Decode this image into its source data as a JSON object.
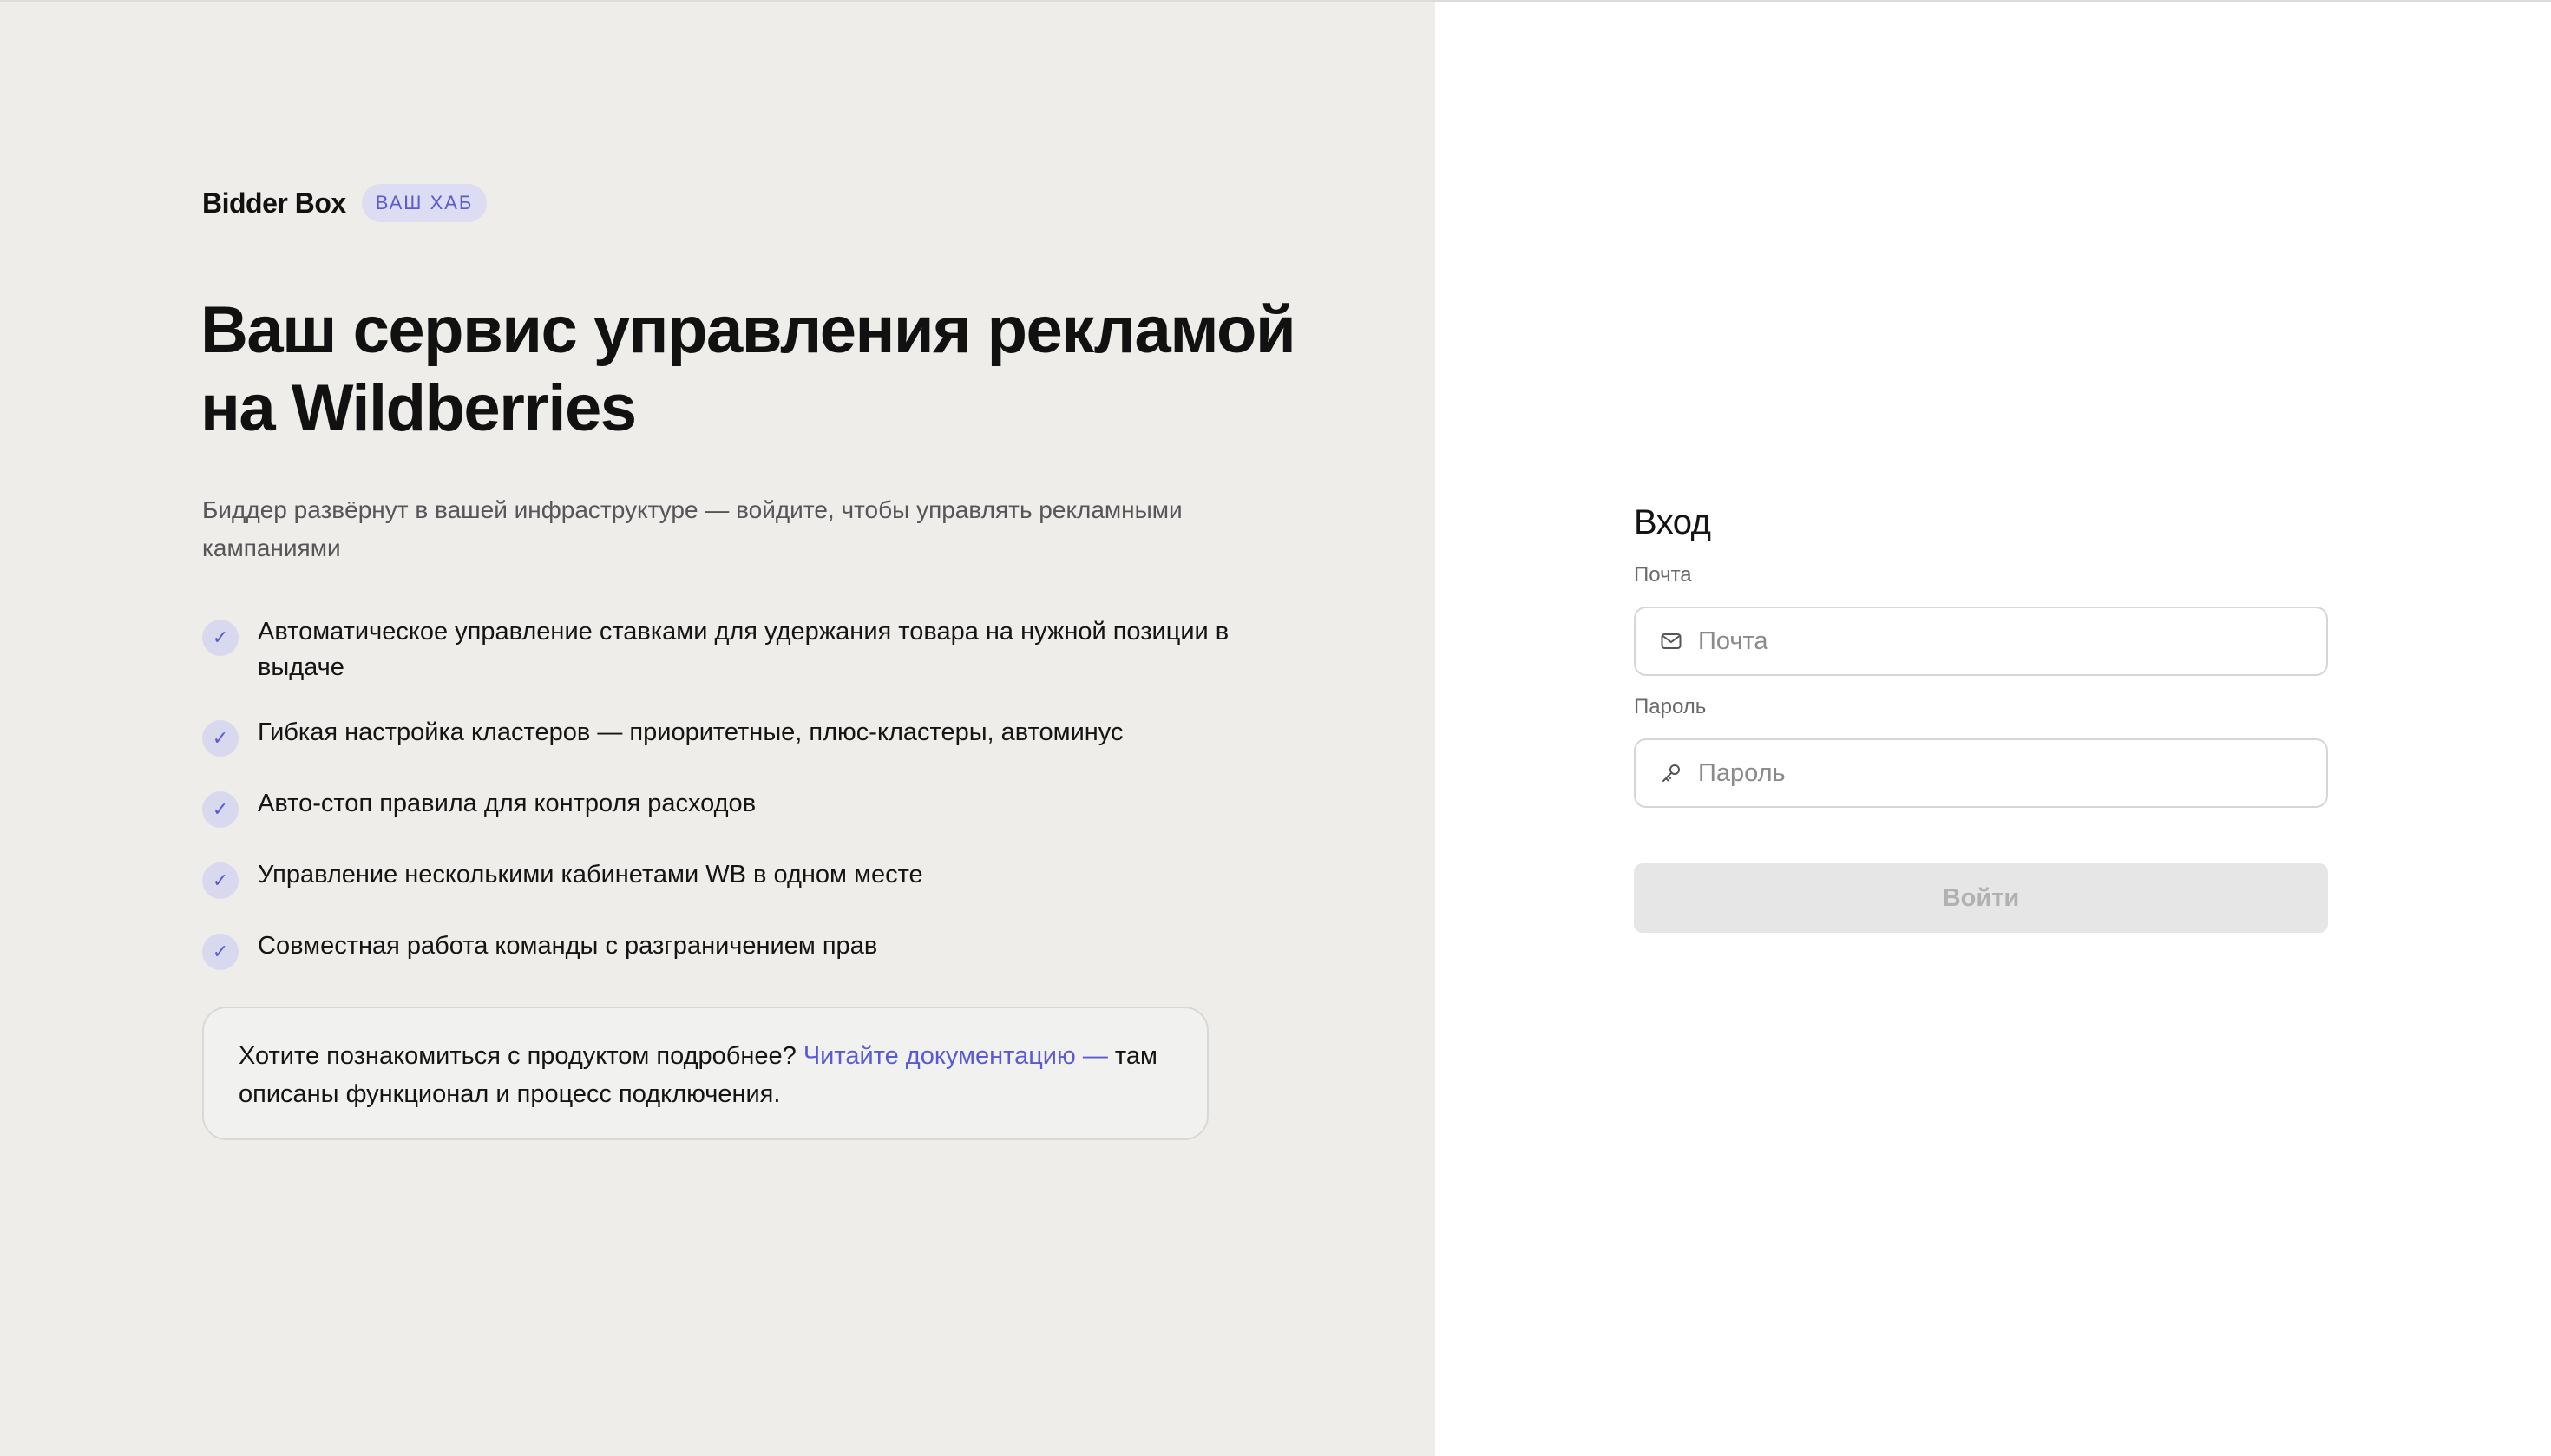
{
  "brand": {
    "name": "Bidder Box",
    "badge": "ВАШ ХАБ"
  },
  "hero": {
    "title": "Ваш сервис управления рекламой на Wildberries",
    "subtitle": "Биддер развёрнут в вашей инфраструктуре — войдите, чтобы управлять рекламными кампаниями"
  },
  "features": [
    "Автоматическое управление ставками для удержания товара на нужной позиции в выдаче",
    "Гибкая настройка кластеров — приоритетные, плюс-кластеры, автоминус",
    "Авто-стоп правила для контроля расходов",
    "Управление несколькими кабинетами WB в одном месте",
    "Совместная работа команды с разграничением прав"
  ],
  "info": {
    "prefix": "Хотите познакомиться с продуктом подробнее? ",
    "link": "Читайте документацию —",
    "suffix": " там описаны функционал и процесс подключения."
  },
  "login": {
    "title": "Вход",
    "email_label": "Почта",
    "email_placeholder": "Почта",
    "email_value": "",
    "password_label": "Пароль",
    "password_placeholder": "Пароль",
    "password_value": "",
    "submit": "Войти"
  },
  "icons": {
    "check": "check-icon",
    "email": "mail-icon",
    "password": "key-icon"
  },
  "colors": {
    "left_bg": "#eeedea",
    "accent": "#5a5ad2",
    "badge_bg": "#dcdcf3",
    "button_disabled_bg": "#e6e6e6",
    "button_disabled_text": "#b1b1b1"
  }
}
